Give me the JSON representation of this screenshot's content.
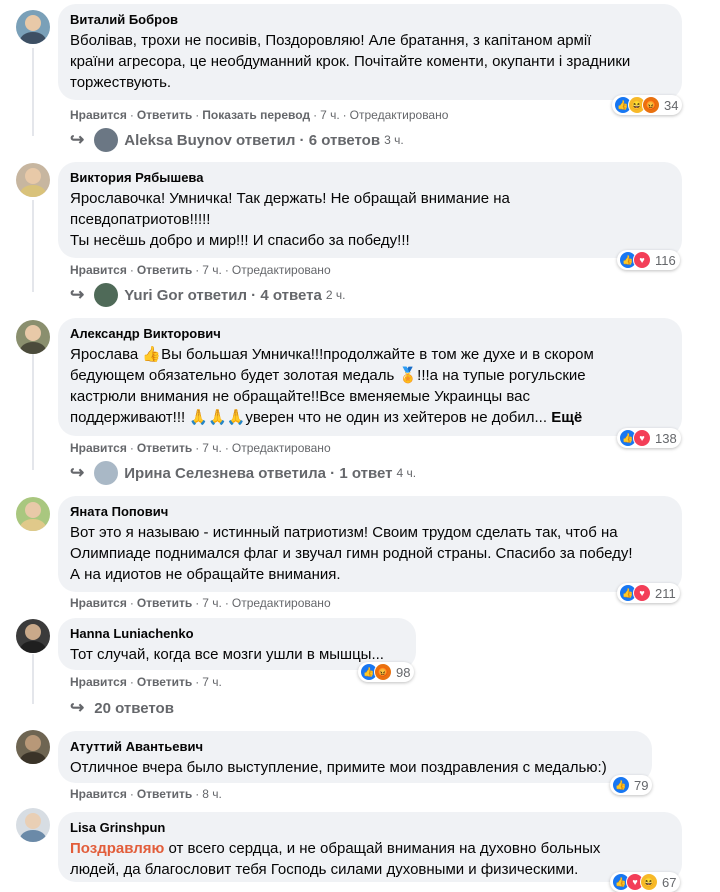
{
  "actions": {
    "like": "Нравится",
    "reply": "Ответить",
    "translate": "Показать перевод",
    "edited": "Отредактировано"
  },
  "comments": [
    {
      "author": "Виталий Бобров",
      "lines": [
        "Вболівав, трохи не посивів, Поздоровляю! Але братання, з капітаном армії",
        "країни агресора, це необдуманний крок. Почітайте коменти, окупанти і зрадники",
        "торжествують."
      ],
      "time": "7 ч.",
      "reaction_count": "34",
      "reactions": [
        "like",
        "haha",
        "angry"
      ],
      "reply": {
        "name": "Aleksa Buynov",
        "verb": "ответил",
        "count": "6 ответов",
        "time": "3 ч."
      }
    },
    {
      "author": "Виктория Рябышева",
      "lines": [
        "Ярославочка! Умничка! Так держать! Не обращай внимание на",
        "псевдопатриотов!!!!!",
        "Ты несёшь добро и мир!!! И спасибо за победу!!!"
      ],
      "time": "7 ч.",
      "reaction_count": "116",
      "reactions": [
        "like",
        "love"
      ],
      "reply": {
        "name": "Yuri Gor",
        "verb": "ответил",
        "count": "4 ответа",
        "time": "2 ч."
      }
    },
    {
      "author": "Александр Викторович",
      "lines": [
        "Ярослава 👍Вы большая Умничка!!!продолжайте в том же духе и в скором",
        "бедующем обязательно будет золотая медаль 🏅!!!а на тупые рогульские",
        "кастрюли внимания не обращайте!!Все вменяемые Украинцы вас",
        "поддерживают!!! 🙏🙏🙏уверен что не один из хейтеров не добил..."
      ],
      "more": "Ещё",
      "time": "7 ч.",
      "reaction_count": "138",
      "reactions": [
        "like",
        "love"
      ],
      "reply": {
        "name": "Ирина Селезнева",
        "verb": "ответила",
        "count": "1 ответ",
        "time": "4 ч."
      }
    },
    {
      "author": "Яната Попович",
      "lines": [
        "Вот это я называю - истинный патриотизм! Своим трудом сделать так, чтоб на",
        "Олимпиаде поднимался флаг и звучал гимн родной страны. Спасибо за победу!",
        "А на идиотов не обращайте внимания."
      ],
      "time": "7 ч.",
      "reaction_count": "211",
      "reactions": [
        "like",
        "love"
      ]
    },
    {
      "author": "Hanna Luniachenko",
      "lines": [
        "Тот случай, когда все мозги ушли в мышцы..."
      ],
      "time": "7 ч.",
      "reaction_count": "98",
      "reactions": [
        "like",
        "angry"
      ],
      "replies_link": "20 ответов"
    },
    {
      "author": "Атуттий Авантьевич",
      "lines": [
        "Отличное вчера было выступление, примите мои поздравления с медалью:)"
      ],
      "time": "8 ч.",
      "reaction_count": "79",
      "reactions": [
        "like"
      ]
    },
    {
      "author": "Lisa Grinshpun",
      "highlight": "Поздравляю",
      "lines": [
        " от всего сердца, и не обращай внимания на духовно больных",
        "людей, да благословит тебя Господь силами духовными и физическими."
      ],
      "time": "",
      "reaction_count": "67",
      "reactions": [
        "like",
        "love",
        "haha"
      ]
    }
  ]
}
